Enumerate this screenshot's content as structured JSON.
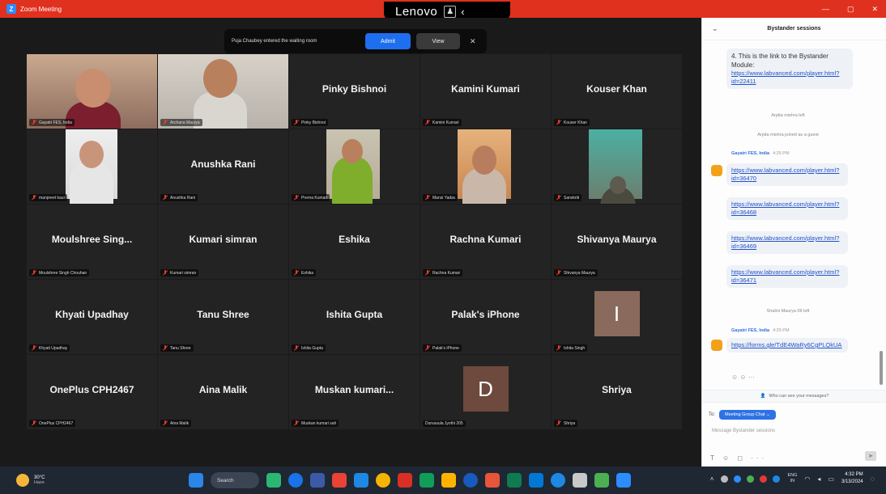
{
  "window": {
    "title": "Zoom Meeting",
    "icon_glyph": "Z",
    "controls": [
      "—",
      "▢",
      "✕"
    ]
  },
  "bezel": {
    "brand": "Lenovo",
    "camera_icon": "camera-shutter-icon",
    "arrow": "‹"
  },
  "notice": {
    "text": "Puja Chaubey entered the waiting room",
    "admit_label": "Admit",
    "view_label": "View",
    "close_glyph": "✕"
  },
  "participants": [
    {
      "display": "",
      "label": "Gayatri FES, India",
      "video": "woman-dark-hair"
    },
    {
      "display": "",
      "label": "Archana Maurya",
      "video": "man-glasses",
      "active": true
    },
    {
      "display": "Pinky Bishnoi",
      "label": "Pinky Bishnoi"
    },
    {
      "display": "Kamini Kumari",
      "label": "Kamini Kumari"
    },
    {
      "display": "Kouser Khan",
      "label": "Kouser Khan"
    },
    {
      "display": "",
      "label": "manpreet kaur",
      "video": "woman-glasses"
    },
    {
      "display": "Anushka Rani",
      "label": "Anushka Rani"
    },
    {
      "display": "",
      "label": "Prerna Kumari",
      "video": "girl-green"
    },
    {
      "display": "",
      "label": "Mansi Yadav",
      "video": "woman-room"
    },
    {
      "display": "",
      "label": "Sanskriti",
      "video": "dim-teal"
    },
    {
      "display": "Moulshree Sing...",
      "label": "Moulshree Singh Chouhan"
    },
    {
      "display": "Kumari simran",
      "label": "Kumari simran"
    },
    {
      "display": "Eshika",
      "label": "Eshika"
    },
    {
      "display": "Rachna Kumari",
      "label": "Rachna Kumari"
    },
    {
      "display": "Shivanya Maurya",
      "label": "Shivanya Maurya"
    },
    {
      "display": "Khyati Upadhay",
      "label": "Khyati Upadhay"
    },
    {
      "display": "Tanu Shree",
      "label": "Tanu Shree"
    },
    {
      "display": "Ishita Gupta",
      "label": "Ishita Gupta"
    },
    {
      "display": "Palak's iPhone",
      "label": "Palak's iPhone"
    },
    {
      "display": "",
      "label": "Ishita Singh",
      "avatar_letter": "I",
      "avatar_color": "#8a6a5c"
    },
    {
      "display": "OnePlus CPH2467",
      "label": "OnePlus CPH2467"
    },
    {
      "display": "Aina Malik",
      "label": "Aina Malik"
    },
    {
      "display": "Muskan kumari...",
      "label": "Muskan kumari sah"
    },
    {
      "display": "",
      "label": "Durvasula Jyothi 205",
      "avatar_letter": "D",
      "avatar_color": "#6d4a3d",
      "no_mic": true
    },
    {
      "display": "Shriya",
      "label": "Shriya"
    }
  ],
  "chat": {
    "title": "Bystander sessions",
    "collapse_glyph": "⌄",
    "bubble1_text": "4. This is the link to the Bystander Module:",
    "bubble1_link": "https://www.labvanced.com/player.html?id=22411",
    "sys1": "Arpita mishra left",
    "sys2": "Arpita mishra joined as a guest",
    "sender1_name": "Gayatri FES, India",
    "sender1_time": "4:25 PM",
    "links": [
      "https://www.labvanced.com/player.html?id=36470",
      "https://www.labvanced.com/player.html?id=36468",
      "https://www.labvanced.com/player.html?id=36469",
      "https://www.labvanced.com/player.html?id=36471"
    ],
    "sys3": "Shalini Maurya 09 left",
    "sender2_name": "Gayatri FES, India",
    "sender2_time": "4:25 PM",
    "form_link": "https://forms.gle/TdE4WaRy6CgPLQkUA",
    "reactions": "☺ ☺ ···",
    "who_can_see": "Who can see your messages?",
    "to_label": "To:",
    "to_chip": "Meeting Group Chat ⌄",
    "placeholder": "Message Bystander sessions",
    "composer_tools": "T ☺ ◻ ···",
    "send_glyph": "➤"
  },
  "taskbar": {
    "weather_temp": "30°C",
    "weather_cond": "Haze",
    "search_label": "Search",
    "apps": [
      "#2a86e8",
      "#2bb673",
      "#1a73e8",
      "#3d5aa8",
      "#ea4335",
      "#1e88e5",
      "#f4b400",
      "#d93025",
      "#0f9d58",
      "#ffb300",
      "#185abd",
      "#e8553a",
      "#0f7b4f",
      "#0078d4",
      "#1e88e5",
      "#c8c8c8",
      "#4caf50",
      "#2d8cff"
    ],
    "tray_colors": [
      "#bbb",
      "#2d8cff",
      "#4caf50",
      "#e53935",
      "#1e88e5"
    ],
    "lang_line1": "ENG",
    "lang_line2": "IN",
    "time": "4:32 PM",
    "date": "3/13/2024"
  }
}
